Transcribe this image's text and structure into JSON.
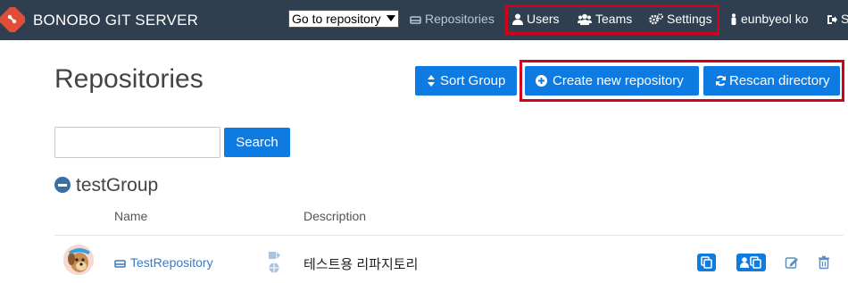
{
  "navbar": {
    "brand": "BONOBO GIT SERVER",
    "goto_select": "Go to repository",
    "repositories": "Repositories",
    "users": "Users",
    "teams": "Teams",
    "settings": "Settings",
    "user": "eunbyeol ko",
    "logout_partial": "S"
  },
  "main": {
    "title": "Repositories",
    "sort_group": "Sort Group",
    "create_repo": "Create new repository",
    "rescan": "Rescan directory",
    "search_placeholder": "",
    "search_button": "Search"
  },
  "group": {
    "name": "testGroup",
    "columns": {
      "name": "Name",
      "description": "Description"
    },
    "rows": [
      {
        "name": "TestRepository",
        "description": "테스트용 리파지토리"
      }
    ]
  },
  "colors": {
    "navbar": "#2f3f4f",
    "primary": "#0e7be3",
    "highlight": "#d0021b",
    "link": "#3a7bbf"
  }
}
